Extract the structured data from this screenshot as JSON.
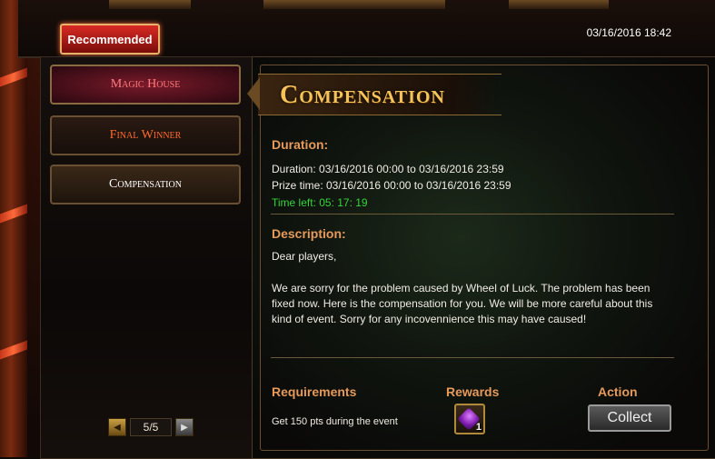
{
  "header": {
    "recommended_tab": "Recommended",
    "datetime": "03/16/2016 18:42"
  },
  "sidebar": {
    "items": [
      {
        "label": "Magic House"
      },
      {
        "label": "Final Winner"
      },
      {
        "label": "Compensation"
      }
    ],
    "pager": {
      "value": "5/5",
      "prev_icon": "left-arrow-icon",
      "next_icon": "right-arrow-icon"
    }
  },
  "event": {
    "title": "Compensation",
    "duration_heading": "Duration:",
    "duration_line": "Duration: 03/16/2016 00:00 to 03/16/2016 23:59",
    "prize_line": "Prize time: 03/16/2016 00:00 to 03/16/2016 23:59",
    "time_left": "Time left: 05: 17: 19",
    "description_heading": "Description:",
    "greeting": "Dear players,",
    "body": "We are sorry for the problem caused by Wheel of Luck. The problem has been fixed now. Here is the compensation for you. We will be more careful about this kind of event. Sorry for any incovennience this may have caused!",
    "requirements_heading": "Requirements",
    "rewards_heading": "Rewards",
    "action_heading": "Action",
    "requirement_text": "Get 150 pts during the event",
    "reward_quantity": "1",
    "reward_icon": "purple-gem-chest-icon",
    "collect_label": "Collect"
  },
  "colors": {
    "heading": "#e69a5a",
    "title_gold": "#f5c35a",
    "time_left_green": "#35d43a"
  }
}
